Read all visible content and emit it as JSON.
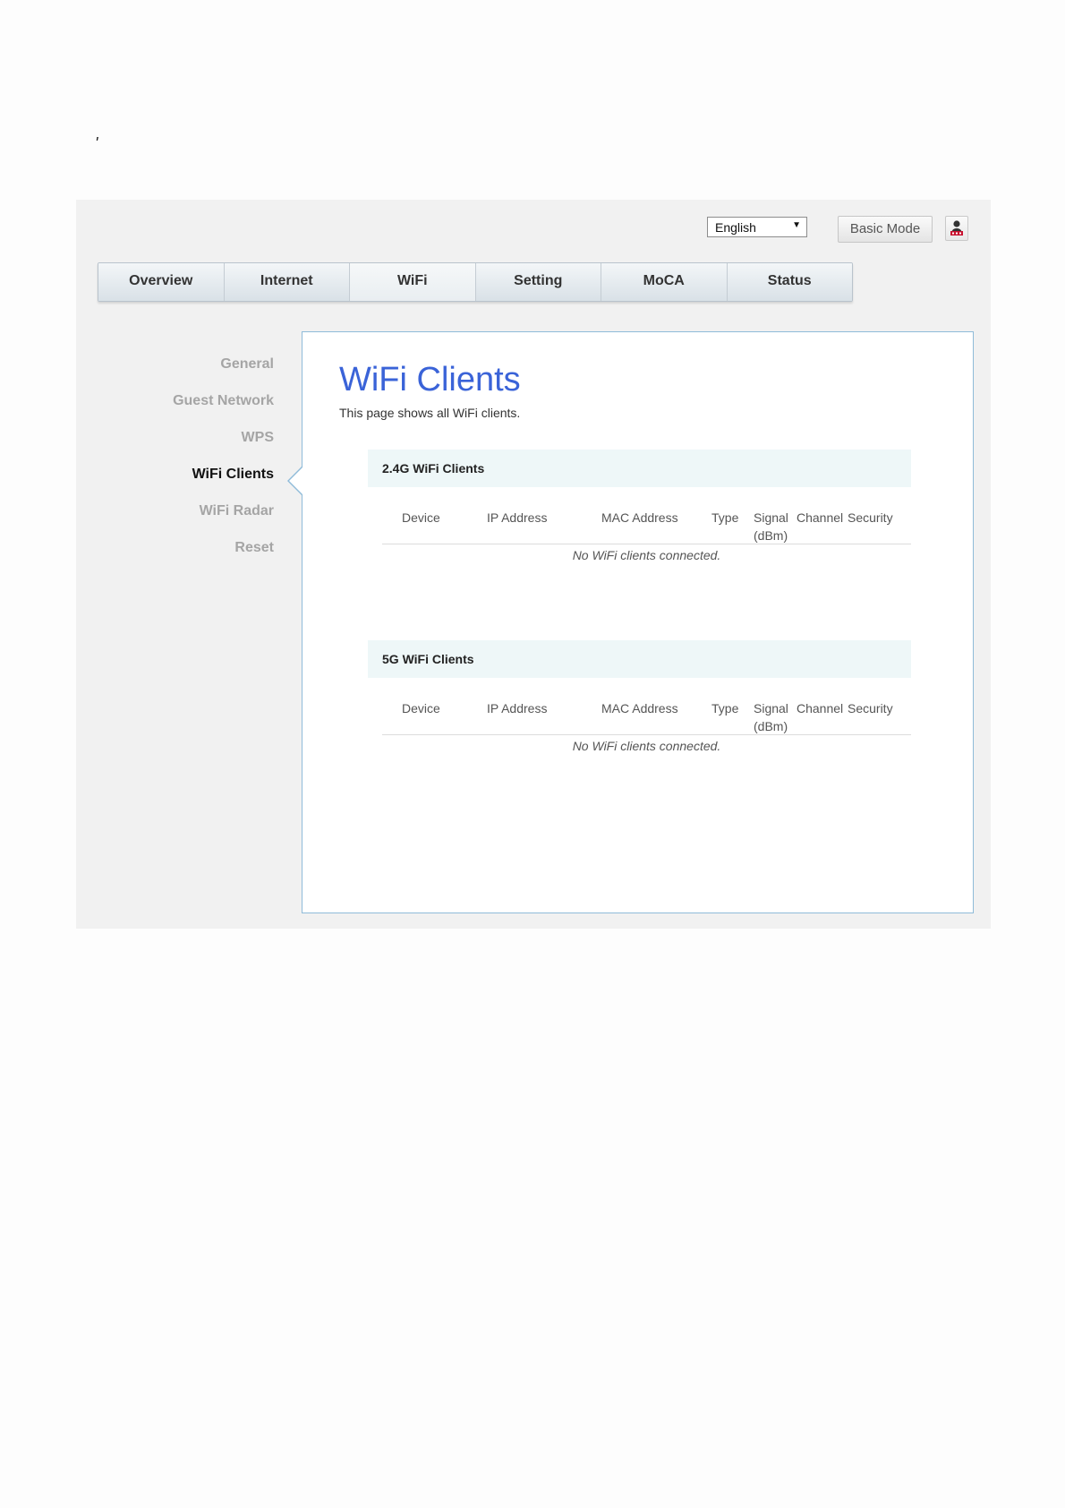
{
  "page_mark": "'",
  "header": {
    "language": "English",
    "mode_button": "Basic Mode"
  },
  "tabs": [
    {
      "label": "Overview"
    },
    {
      "label": "Internet"
    },
    {
      "label": "WiFi"
    },
    {
      "label": "Setting"
    },
    {
      "label": "MoCA"
    },
    {
      "label": "Status"
    }
  ],
  "sidebar": {
    "items": [
      {
        "label": "General"
      },
      {
        "label": "Guest Network"
      },
      {
        "label": "WPS"
      },
      {
        "label": "WiFi Clients"
      },
      {
        "label": "WiFi Radar"
      },
      {
        "label": "Reset"
      }
    ]
  },
  "main": {
    "title": "WiFi Clients",
    "description": "This page shows all WiFi clients.",
    "sections": [
      {
        "title": "2.4G WiFi Clients",
        "columns": {
          "device": "Device",
          "ip": "IP Address",
          "mac": "MAC Address",
          "type": "Type",
          "signal": "Signal",
          "signal_unit": "(dBm)",
          "channel": "Channel",
          "security": "Security"
        },
        "empty_message": "No WiFi clients connected."
      },
      {
        "title": "5G WiFi Clients",
        "columns": {
          "device": "Device",
          "ip": "IP Address",
          "mac": "MAC Address",
          "type": "Type",
          "signal": "Signal",
          "signal_unit": "(dBm)",
          "channel": "Channel",
          "security": "Security"
        },
        "empty_message": "No WiFi clients connected."
      }
    ]
  },
  "colors": {
    "accent": "#3a63d8",
    "panel_border": "#8fbbd9",
    "section_header_bg": "#eef7f8",
    "background": "#f1f1f1"
  },
  "icons": {
    "user": "user-logout-icon",
    "dropdown": "dropdown-arrow-icon"
  }
}
